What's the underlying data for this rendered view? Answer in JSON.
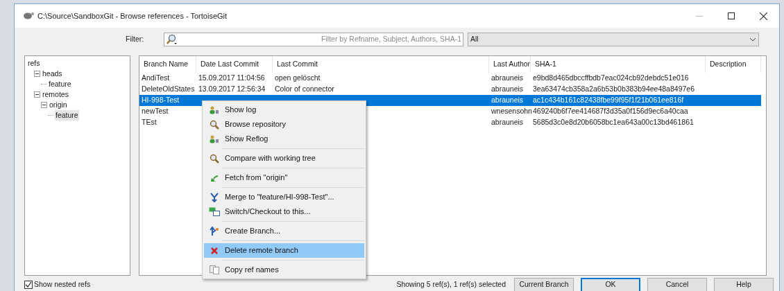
{
  "window": {
    "title": "C:\\Source\\SandboxGit - Browse references - TortoiseGit"
  },
  "filter": {
    "label": "Filter:",
    "placeholder": "Filter by Refname, Subject, Authors, SHA-1",
    "scope": "All"
  },
  "tree": [
    {
      "label": "refs",
      "selected": false,
      "children": [
        {
          "label": "heads",
          "expanded": true,
          "selected": false,
          "children": [
            {
              "label": "feature",
              "selected": false
            }
          ]
        },
        {
          "label": "remotes",
          "expanded": true,
          "selected": false,
          "children": [
            {
              "label": "origin",
              "expanded": true,
              "selected": false,
              "children": [
                {
                  "label": "feature",
                  "selected": true
                }
              ]
            }
          ]
        }
      ]
    }
  ],
  "table": {
    "columns": [
      "Branch Name",
      "Date Last Commit",
      "Last Commit",
      "Last Author",
      "SHA-1",
      "Description"
    ],
    "rows": [
      {
        "cells": [
          "AndiTest",
          "15.09.2017 11:04:56",
          "open gelöscht",
          "abrauneis",
          "e9bd8d465dbccffbdb7eac024cb92debdc51e016",
          ""
        ],
        "selected": false
      },
      {
        "cells": [
          "DeleteOldStates",
          "13.09.2017 12:56:34",
          "Color of connector",
          "abrauneis",
          "3ea63474cb358a2a6b53b0b383b94ee48a8497e6",
          ""
        ],
        "selected": false
      },
      {
        "cells": [
          "HI-998-Test",
          "",
          "",
          "abrauneis",
          "ac1c434b161c82438fbe99f95f1f21b061ee816f",
          ""
        ],
        "selected": true
      },
      {
        "cells": [
          "newTest",
          "",
          "",
          "wnesensohn",
          "469240b6f7ee414687f3d35a0f156d9ec6a40caa",
          ""
        ],
        "selected": false
      },
      {
        "cells": [
          "TEst",
          "",
          "",
          "abrauneis",
          "5685d3c0e8d20b6058bc1ea643a00c13bd461861",
          ""
        ],
        "selected": false
      }
    ]
  },
  "context_menu": {
    "items": [
      {
        "kind": "item",
        "label": "Show log",
        "selected": false
      },
      {
        "kind": "item",
        "label": "Browse repository",
        "selected": false
      },
      {
        "kind": "item",
        "label": "Show Reflog",
        "selected": false
      },
      {
        "kind": "separator"
      },
      {
        "kind": "item",
        "label": "Compare with working tree",
        "selected": false
      },
      {
        "kind": "separator"
      },
      {
        "kind": "item",
        "label": "Fetch from \"origin\"",
        "selected": false
      },
      {
        "kind": "separator"
      },
      {
        "kind": "item",
        "label": "Merge to \"feature/HI-998-Test\"...",
        "selected": false
      },
      {
        "kind": "item",
        "label": "Switch/Checkout to this...",
        "selected": false
      },
      {
        "kind": "separator"
      },
      {
        "kind": "item",
        "label": "Create Branch...",
        "selected": false
      },
      {
        "kind": "separator"
      },
      {
        "kind": "item",
        "label": "Delete remote branch",
        "selected": true
      },
      {
        "kind": "separator"
      },
      {
        "kind": "item",
        "label": "Copy ref names",
        "selected": false
      }
    ]
  },
  "show_nested_refs": {
    "label": "Show nested refs",
    "checked": true
  },
  "status": "Showing 5 ref(s), 1 ref(s) selected",
  "buttons": [
    {
      "label": "Current Branch",
      "default": false
    },
    {
      "label": "OK",
      "default": true
    },
    {
      "label": "Cancel",
      "default": false
    },
    {
      "label": "Help",
      "default": false
    }
  ]
}
